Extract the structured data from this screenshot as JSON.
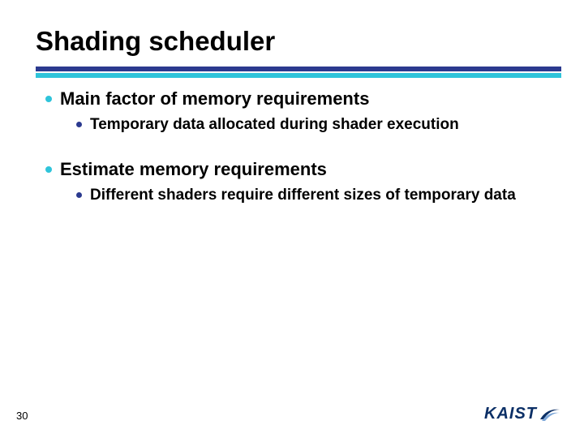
{
  "title": "Shading scheduler",
  "bullets": {
    "b1": "Main factor of memory requirements",
    "b1_1": "Temporary data allocated during shader execution",
    "b2": "Estimate memory requirements",
    "b2_1": "Different shaders require different sizes of temporary data"
  },
  "page_number": "30",
  "logo_text": "KAIST"
}
